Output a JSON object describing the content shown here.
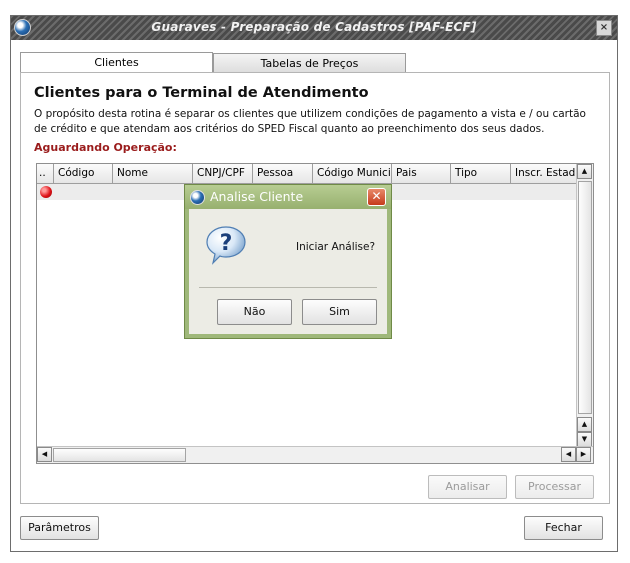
{
  "window": {
    "title": "Guaraves - Preparação de Cadastros [PAF-ECF]",
    "close_label": "×"
  },
  "tabs": [
    {
      "label": "Clientes"
    },
    {
      "label": "Tabelas de Preços"
    }
  ],
  "content": {
    "heading": "Clientes para o Terminal de Atendimento",
    "description": "O propósito desta rotina é separar os clientes que utilizem condições de pagamento a vista e / ou cartão de crédito e que atendam aos critérios do SPED Fiscal quanto ao preenchimento dos seus dados.",
    "status": "Aguardando Operação:"
  },
  "grid": {
    "columns": [
      "..",
      "Código",
      "Nome",
      "CNPJ/CPF",
      "Pessoa",
      "Código Municip",
      "Pais",
      "Tipo",
      "Inscr. Estadu"
    ],
    "rows": [
      {
        "status_icon": "red-status-icon"
      }
    ]
  },
  "buttons": {
    "analisar": "Analisar",
    "processar": "Processar",
    "parametros": "Parâmetros",
    "fechar": "Fechar"
  },
  "dialog": {
    "title": "Analise Cliente",
    "close_label": "✕",
    "message": "Iniciar Análise?",
    "no_label": "Não",
    "yes_label": "Sim",
    "icon": "question-icon"
  },
  "colors": {
    "status_text": "#9a1c1c",
    "dialog_frame": "#9fb87a",
    "dialog_close": "#c63b1c"
  }
}
